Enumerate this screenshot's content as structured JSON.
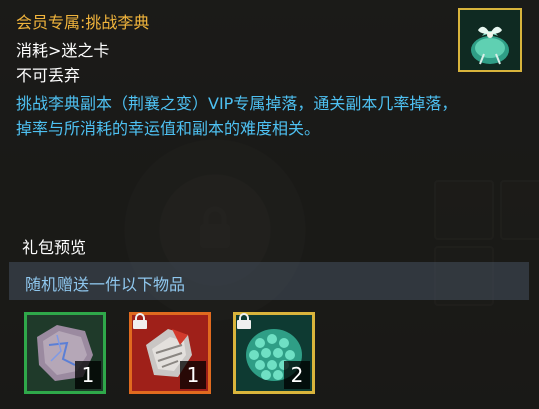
{
  "tooltip": {
    "title": "会员专属:挑战李典",
    "cost_line": "消耗>迷之卡",
    "droppable_line": "不可丢弃",
    "description_line1": "挑战李典副本（荆襄之变）VIP专属掉落，通关副本几率掉落，",
    "description_line2": "掉率与所消耗的幸运值和副本的难度相关。",
    "item_icon": "green-gift-pouch-icon"
  },
  "preview": {
    "section_label": "礼包预览",
    "sub_label": "随机赠送一件以下物品",
    "rewards": [
      {
        "icon": "broken-map-fragment-icon",
        "count": "1",
        "frame_color": "#2fa84a",
        "locked": false
      },
      {
        "icon": "red-gauntlet-armor-icon",
        "count": "1",
        "frame_color": "#e06a1f",
        "locked": true
      },
      {
        "icon": "green-dragon-scale-icon",
        "count": "2",
        "frame_color": "#d9b43c",
        "locked": true
      }
    ]
  },
  "colors": {
    "title": "#f0b43c",
    "description": "#4ec1f2",
    "sub_label": "#8fc7ee"
  }
}
